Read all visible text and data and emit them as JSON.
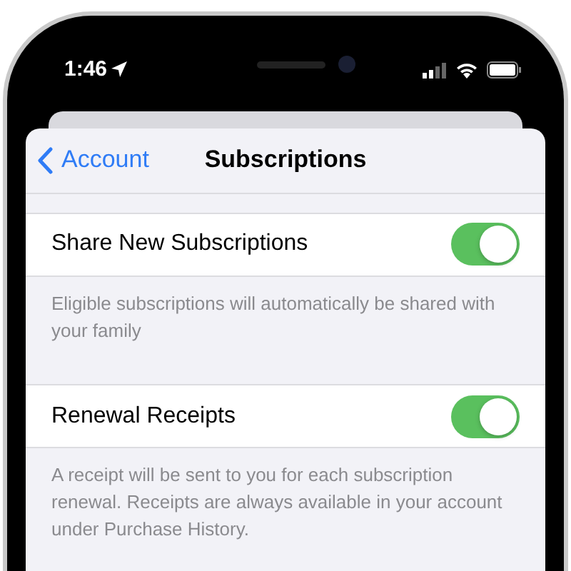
{
  "status_bar": {
    "time": "1:46"
  },
  "nav": {
    "back": "Account",
    "title": "Subscriptions"
  },
  "settings": [
    {
      "label": "Share New Subscriptions",
      "on": true,
      "footer": "Eligible subscriptions will automatically be shared with your family"
    },
    {
      "label": "Renewal Receipts",
      "on": true,
      "footer": "A receipt will be sent to you for each subscription renewal. Receipts are always available in your account under Purchase History."
    }
  ]
}
